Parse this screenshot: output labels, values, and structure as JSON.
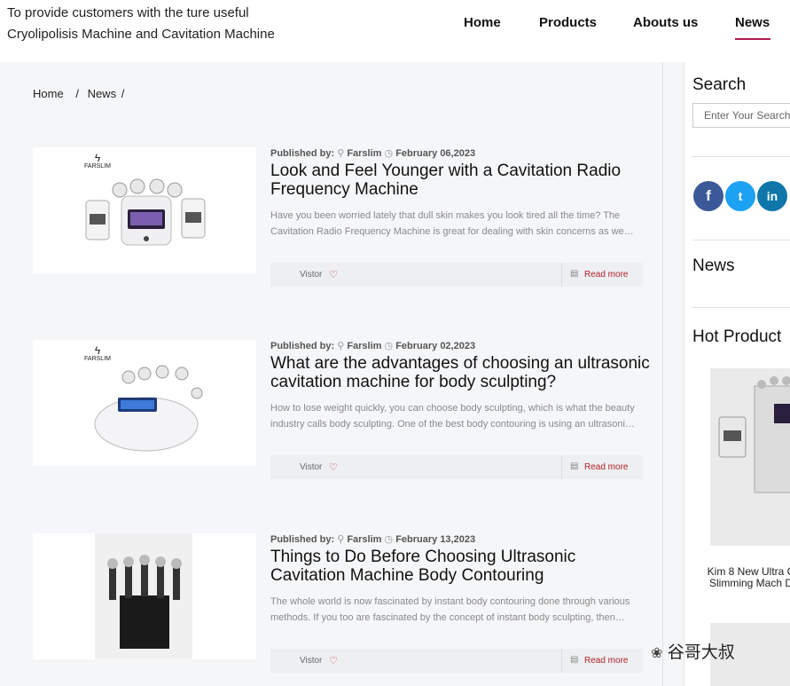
{
  "header": {
    "tagline_line1": "To provide customers with the ture useful",
    "tagline_line2": "Cryolipolisis Machine and Cavitation Machine",
    "nav": [
      "Home",
      "Products",
      "Abouts us",
      "News"
    ],
    "active_nav": "News"
  },
  "breadcrumb": {
    "home": "Home",
    "sep": "/",
    "current": "News",
    "trail": "/"
  },
  "posts": [
    {
      "published_label": "Published by:",
      "author": "Farslim",
      "date": "February 06,2023",
      "title": "Look and Feel Younger with a Cavitation Radio Frequency Machine",
      "excerpt": "Have you been worried lately that dull skin makes you look tired all the time? The Cavitation Radio Frequency Machine is great for dealing with skin concerns as we…",
      "vistor": "Vistor",
      "read_more": "Read more",
      "brand": "FARSLIM"
    },
    {
      "published_label": "Published by:",
      "author": "Farslim",
      "date": "February 02,2023",
      "title": "What are the advantages of choosing an ultrasonic cavitation machine for body sculpting?",
      "excerpt": "How to lose weight quickly, you can choose body sculpting, which is what the beauty industry calls body sculpting. One of the best body contouring is using an ultrasoni…",
      "vistor": "Vistor",
      "read_more": "Read more",
      "brand": "FARSLIM"
    },
    {
      "published_label": "Published by:",
      "author": "Farslim",
      "date": "February 13,2023",
      "title": "Things to Do Before Choosing Ultrasonic Cavitation Machine Body Contouring",
      "excerpt": "The whole world is now fascinated by instant body contouring done through various methods. If you too are fascinated by the concept of instant body sculpting, then…",
      "vistor": "Vistor",
      "read_more": "Read more",
      "brand": ""
    }
  ],
  "sidebar": {
    "search_heading": "Search",
    "search_placeholder": "Enter Your Search",
    "social": [
      "f",
      "t",
      "in"
    ],
    "news_heading": "News",
    "hot_product_heading": "Hot Product",
    "hot_product_caption": "Kim 8 New Ultra C Slimming Mach D"
  },
  "watermark": "谷哥大叔",
  "colors": {
    "accent": "#b01a4a",
    "facebook": "#3b5998",
    "twitter": "#1da1f2",
    "linkedin": "#0e76a8",
    "read_more": "#b0202a"
  }
}
